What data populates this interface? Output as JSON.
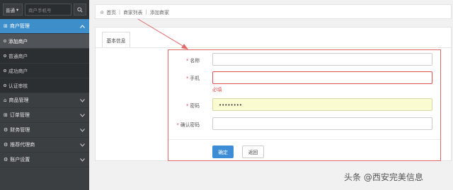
{
  "sidebar": {
    "search": {
      "select_label": "普通",
      "placeholder": "商户手机号"
    },
    "groups": [
      {
        "label": "商户管理",
        "active": true
      },
      {
        "label": "商品管理"
      },
      {
        "label": "订单管理"
      },
      {
        "label": "财务管理"
      },
      {
        "label": "推荐代理商"
      },
      {
        "label": "账户设置"
      }
    ],
    "sub_items": [
      {
        "label": "添加商户",
        "active": true
      },
      {
        "label": "普通商户"
      },
      {
        "label": "成功商户"
      },
      {
        "label": "认证审核"
      }
    ]
  },
  "breadcrumb": {
    "home": "首页",
    "list": "商家列表",
    "current": "添加商家"
  },
  "tab": {
    "label": "基本信息"
  },
  "form": {
    "name_label": "名称",
    "phone_label": "手机",
    "phone_error": "必填",
    "password_label": "密码",
    "password_value": "••••••••",
    "confirm_label": "确认密码"
  },
  "buttons": {
    "confirm": "确定",
    "back": "返回"
  },
  "watermark": "头条 @西安完美信息",
  "colors": {
    "accent": "#3d8ec9",
    "error": "#e05151",
    "annotation": "#e06a6a"
  }
}
